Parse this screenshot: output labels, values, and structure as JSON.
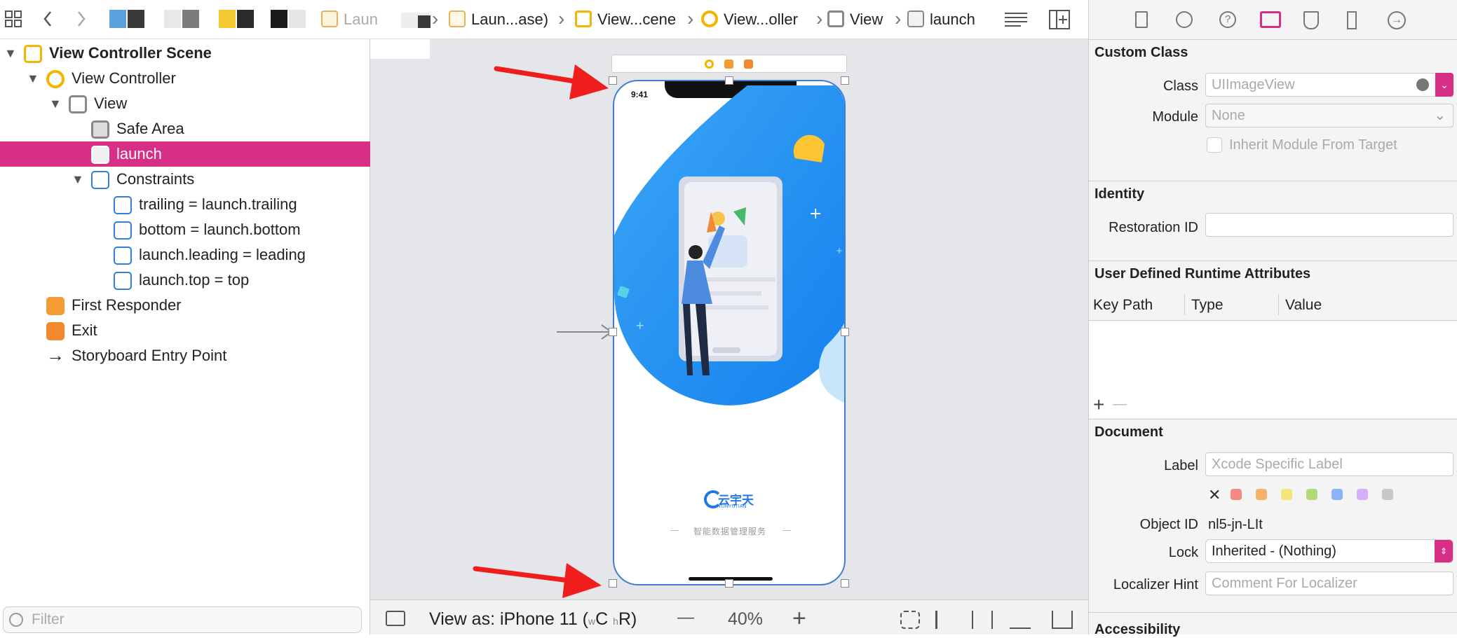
{
  "toolbar": {
    "breadcrumbs": [
      "Laun",
      "Laun...ase)",
      "View...cene",
      "View...oller",
      "View",
      "launch"
    ],
    "grid_icon": "grid-icon",
    "back_icon": "chevron-left-icon",
    "forward_icon": "chevron-right-icon"
  },
  "outline": {
    "items": [
      {
        "label": "View Controller Scene",
        "bold": true
      },
      {
        "label": "View Controller"
      },
      {
        "label": "View"
      },
      {
        "label": "Safe Area"
      },
      {
        "label": "launch",
        "selected": true
      },
      {
        "label": "Constraints"
      },
      {
        "label": "trailing = launch.trailing"
      },
      {
        "label": "bottom = launch.bottom"
      },
      {
        "label": "launch.leading = leading"
      },
      {
        "label": "launch.top = top"
      },
      {
        "label": "First Responder"
      },
      {
        "label": "Exit"
      },
      {
        "label": "Storyboard Entry Point"
      }
    ],
    "filter_placeholder": "Filter"
  },
  "canvas": {
    "status_time": "9:41",
    "brand_name": "云宇天",
    "brand_sub": "YUNYUTIAN",
    "tagline": "智能数据管理服务",
    "view_as": "View as: iPhone 11 (",
    "size_class_w": "w",
    "size_class_c": "C",
    "size_class_h": "h",
    "size_class_r": "R)",
    "zoom_minus": "—",
    "zoom": "40%",
    "zoom_plus": "+"
  },
  "inspector": {
    "custom_class_title": "Custom Class",
    "class_label": "Class",
    "class_placeholder": "UIImageView",
    "module_label": "Module",
    "module_placeholder": "None",
    "inherit_label": "Inherit Module From Target",
    "identity_title": "Identity",
    "restoration_label": "Restoration ID",
    "udra_title": "User Defined Runtime Attributes",
    "col_keypath": "Key Path",
    "col_type": "Type",
    "col_value": "Value",
    "add": "+",
    "remove": "—",
    "document_title": "Document",
    "label_label": "Label",
    "label_placeholder": "Xcode Specific Label",
    "object_id_label": "Object ID",
    "object_id": "nl5-jn-LIt",
    "lock_label": "Lock",
    "lock_value": "Inherited - (Nothing)",
    "hint_label": "Localizer Hint",
    "hint_placeholder": "Comment For Localizer",
    "accessibility_title": "Accessibility",
    "label_colors": [
      "#f28b82",
      "#f6b26b",
      "#f3e57a",
      "#b5d77a",
      "#8ab4f8",
      "#d7aefb",
      "#c8c8c8"
    ],
    "accent": "#d82f86"
  }
}
